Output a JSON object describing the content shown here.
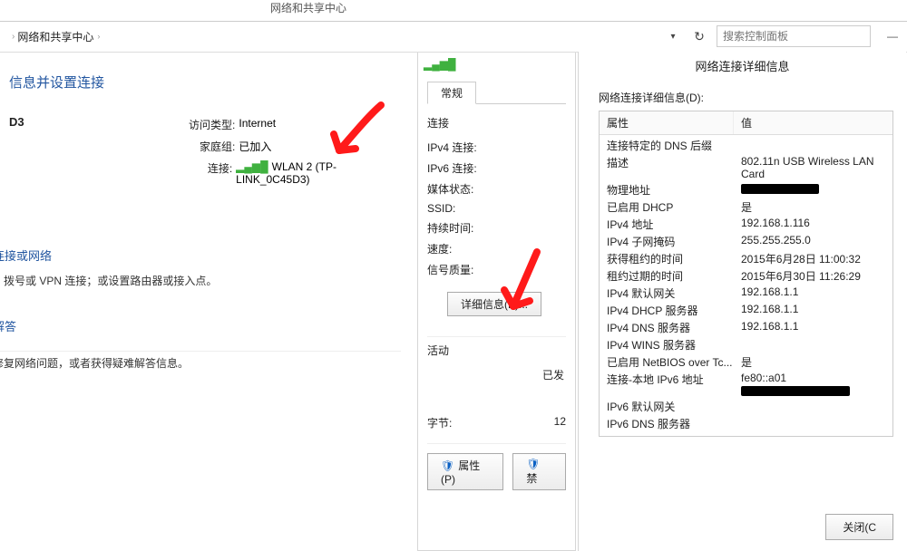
{
  "toolbar": {
    "title": "网络和共享中心",
    "breadcrumb_text": "网络和共享中心",
    "refresh_icon": "↻",
    "search_placeholder": "搜索控制面板",
    "dropdown_caret": "▾",
    "chevron": "›",
    "win_min": "—",
    "win_max": "□",
    "win_close": "✕"
  },
  "left": {
    "section_title": "信息并设置连接",
    "network_name": "D3",
    "access_type_label": "访问类型:",
    "access_type_value": "Internet",
    "homegroup_label": "家庭组:",
    "homegroup_value": "已加入",
    "connection_label": "连接:",
    "connection_value": "WLAN 2 (TP-LINK_0C45D3)",
    "sub1_title": "连接或网络",
    "sub1_text": "、拨号或 VPN 连接；或设置路由器或接入点。",
    "sub2_title": "解答",
    "sub2_text": "修复网络问题，或者获得疑难解答信息。"
  },
  "mid": {
    "signal_icon": "▮",
    "tab_general": "常规",
    "grp_connection": "连接",
    "fields": [
      "IPv4 连接:",
      "IPv6 连接:",
      "媒体状态:",
      "SSID:",
      "持续时间:",
      "速度:",
      "信号质量:"
    ],
    "details_btn": "详细信息(E)...",
    "grp_activity": "活动",
    "sent_label": "已发",
    "bytes_label": "字节:",
    "bytes_value": "12",
    "btn_properties": "属性(P)",
    "btn_disable": "禁"
  },
  "right": {
    "title": "网络连接详细信息",
    "caption": "网络连接详细信息(D):",
    "col_prop": "属性",
    "col_val": "值",
    "rows": [
      {
        "p": "连接特定的 DNS 后缀",
        "v": ""
      },
      {
        "p": "描述",
        "v": "802.11n USB Wireless LAN Card"
      },
      {
        "p": "物理地址",
        "v": "__REDACT_86__"
      },
      {
        "p": "已启用 DHCP",
        "v": "是"
      },
      {
        "p": "IPv4 地址",
        "v": "192.168.1.116"
      },
      {
        "p": "IPv4 子网掩码",
        "v": "255.255.255.0"
      },
      {
        "p": "获得租约的时间",
        "v": "2015年6月28日 11:00:32"
      },
      {
        "p": "租约过期的时间",
        "v": "2015年6月30日 11:26:29"
      },
      {
        "p": "IPv4 默认网关",
        "v": "192.168.1.1"
      },
      {
        "p": "IPv4 DHCP 服务器",
        "v": "192.168.1.1"
      },
      {
        "p": "IPv4 DNS 服务器",
        "v": "192.168.1.1"
      },
      {
        "p": "IPv4 WINS 服务器",
        "v": ""
      },
      {
        "p": "已启用 NetBIOS over Tc...",
        "v": "是"
      },
      {
        "p": "连接-本地 IPv6 地址",
        "v": "fe80::a01__REDACT_120__"
      },
      {
        "p": "IPv6 默认网关",
        "v": ""
      },
      {
        "p": "IPv6 DNS 服务器",
        "v": ""
      }
    ],
    "close_btn": "关闭(C"
  }
}
